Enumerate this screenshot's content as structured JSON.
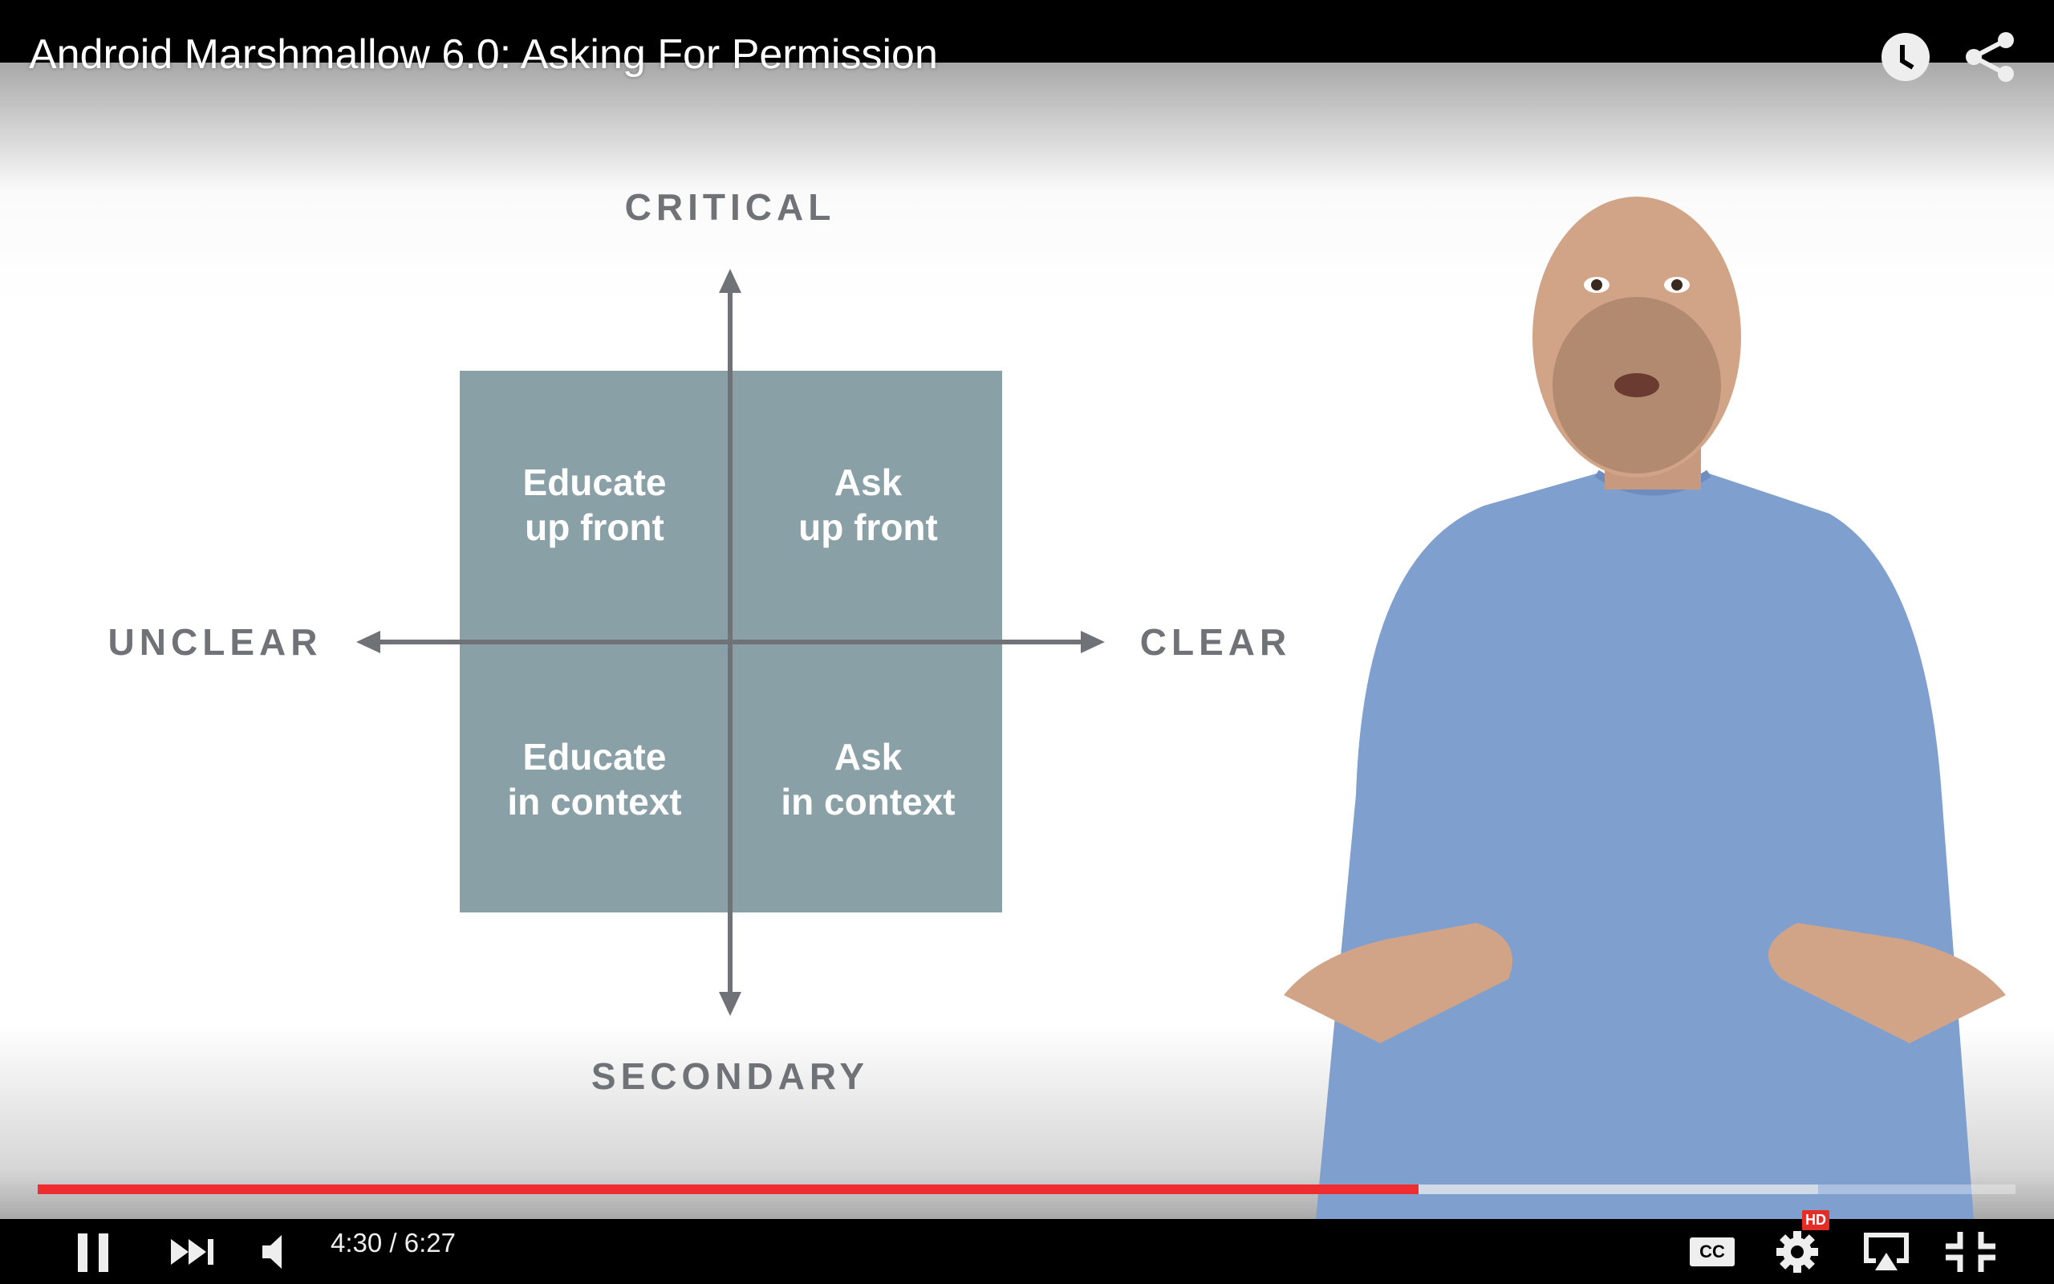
{
  "video": {
    "title": "Android Marshmallow 6.0: Asking For Permission",
    "top_icons": [
      "clock-icon",
      "share-icon"
    ]
  },
  "diagram": {
    "axis_labels": {
      "top": "CRITICAL",
      "bottom": "SECONDARY",
      "left": "UNCLEAR",
      "right": "CLEAR"
    },
    "quadrants": [
      {
        "line1": "Educate",
        "line2": "up front"
      },
      {
        "line1": "Ask",
        "line2": "up front"
      },
      {
        "line1": "Educate",
        "line2": "in context"
      },
      {
        "line1": "Ask",
        "line2": "in context"
      }
    ],
    "box_color": "#8aa0a7",
    "axis_color": "#6f7377"
  },
  "player": {
    "current_time": "4:30",
    "duration": "6:27",
    "time_display": "4:30 / 6:27",
    "played_fraction": 0.698,
    "buffered_fraction": 0.9,
    "progress_color": "#ef2d31",
    "hd_badge": "HD",
    "cc_label": "CC",
    "controls": [
      "pause-icon",
      "next-icon",
      "volume-icon",
      "cc-icon",
      "settings-icon",
      "airplay-icon",
      "exit-fullscreen-icon"
    ]
  }
}
